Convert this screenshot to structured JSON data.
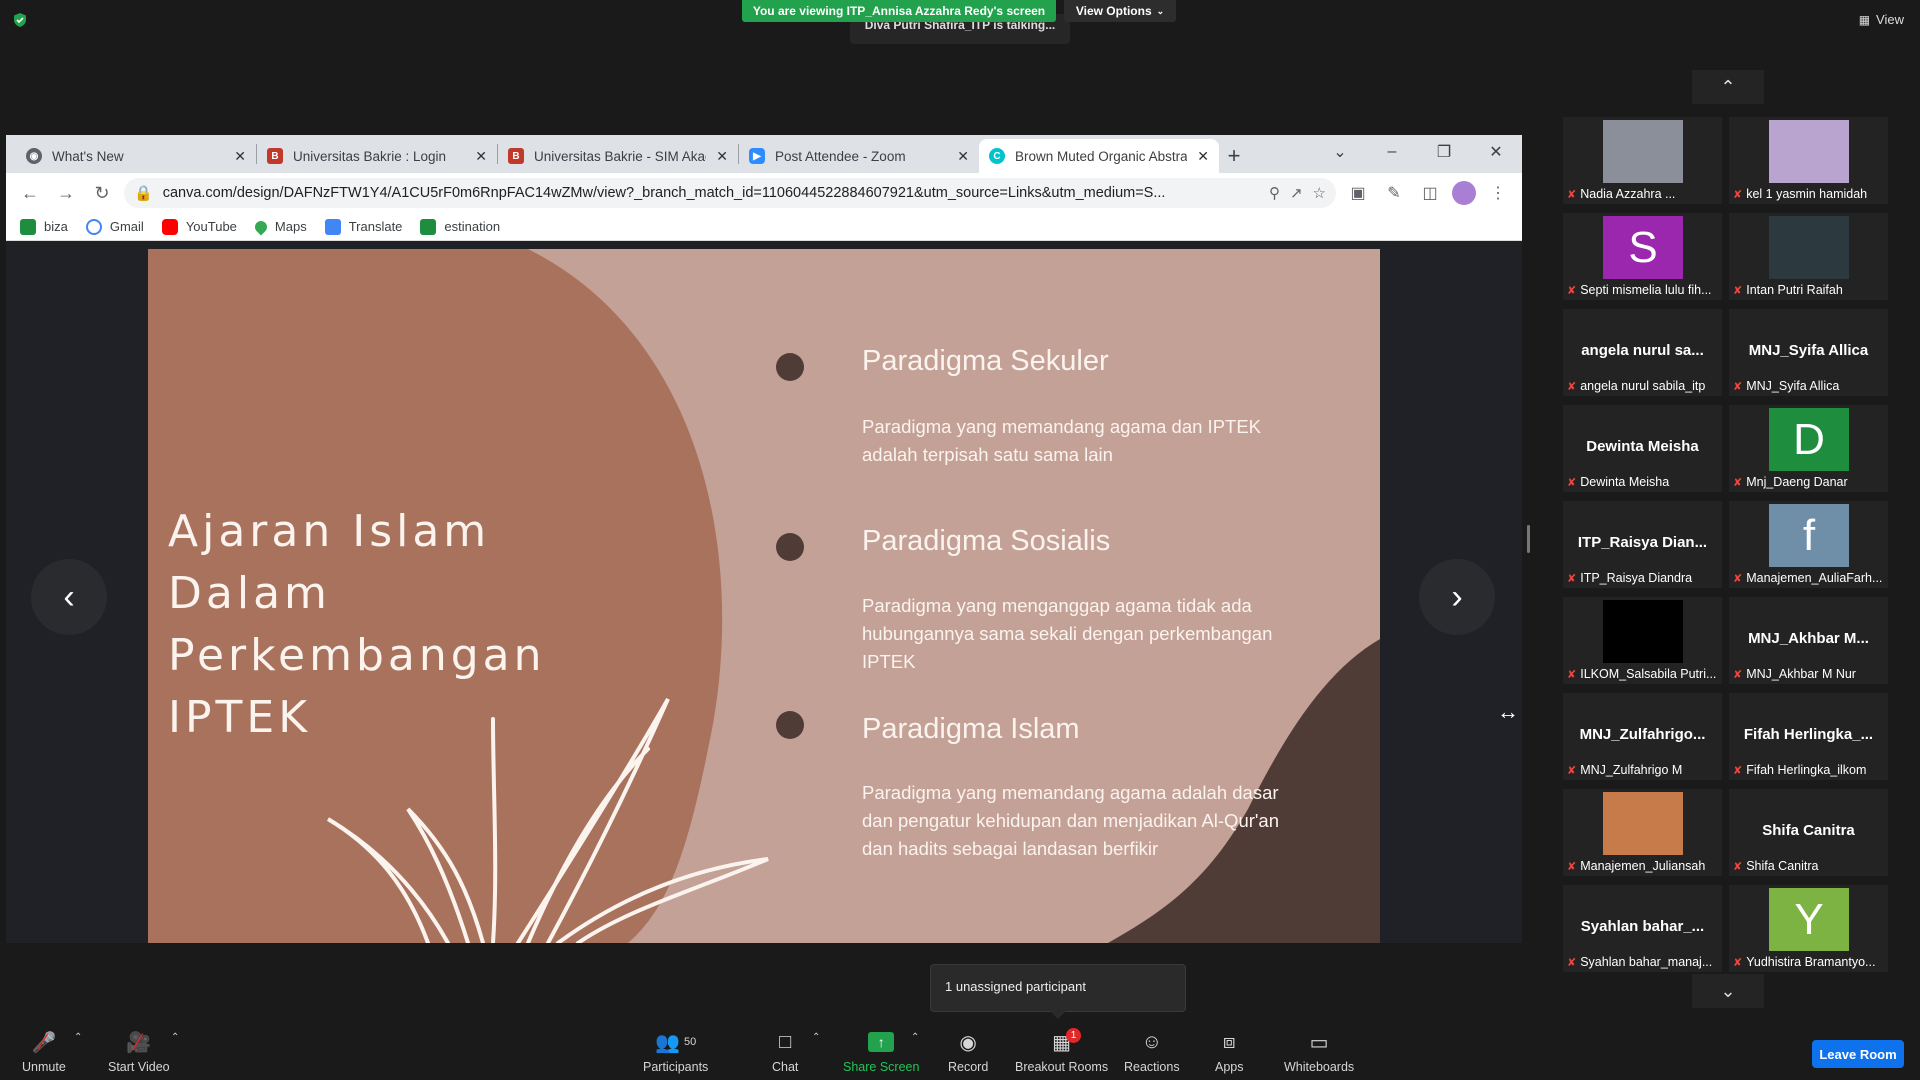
{
  "meeting": {
    "share_banner": "You are viewing ITP_Annisa Azzahra Redy's screen",
    "view_options": "View Options",
    "talking": "Diva Putri Shafira_ITP is talking...",
    "view_label": "View"
  },
  "browser": {
    "tabs": [
      {
        "title": "What's New",
        "icon": "chrome-icon",
        "active": false
      },
      {
        "title": "Universitas Bakrie : Login",
        "icon": "bakrie-icon",
        "active": false
      },
      {
        "title": "Universitas Bakrie - SIM Akad",
        "icon": "bakrie-icon",
        "active": false
      },
      {
        "title": "Post Attendee - Zoom",
        "icon": "zoom-icon",
        "active": false
      },
      {
        "title": "Brown Muted Organic Abstra",
        "icon": "canva-icon",
        "active": true
      }
    ],
    "url": "canva.com/design/DAFNzFTW1Y4/A1CU5rF0m6RnpFAC14wZMw/view?_branch_match_id=1106044522884607921&utm_source=Links&utm_medium=S...",
    "bookmarks": [
      "biza",
      "Gmail",
      "YouTube",
      "Maps",
      "Translate",
      "estination"
    ]
  },
  "slide": {
    "title_lines": [
      "Ajaran Islam",
      "Dalam",
      "Perkembangan",
      "IPTEK"
    ],
    "points": [
      {
        "heading": "Paradigma Sekuler",
        "body": "Paradigma yang memandang agama dan IPTEK adalah terpisah satu sama lain"
      },
      {
        "heading": "Paradigma Sosialis",
        "body": "Paradigma yang menganggap agama tidak ada hubungannya sama sekali dengan perkembangan IPTEK"
      },
      {
        "heading": "Paradigma Islam",
        "body": "Paradigma yang memandang agama adalah dasar dan pengatur kehidupan dan menjadikan Al-Qur'an dan hadits sebagai landasan berfikir"
      }
    ]
  },
  "participants": [
    {
      "label": "Nadia Azzahra ...",
      "big": "",
      "avatar": "photo",
      "color": "#8a8f99"
    },
    {
      "label": "kel 1 yasmin hamidah",
      "big": "",
      "avatar": "photo",
      "color": "#b9a4cf"
    },
    {
      "label": "Septi mismelia lulu fih...",
      "big": "",
      "avatar": "S",
      "color": "#9b27af"
    },
    {
      "label": "Intan Putri Raifah",
      "big": "",
      "avatar": "photo",
      "color": "#2c3a40"
    },
    {
      "label": "angela nurul sabila_itp",
      "big": "angela nurul sa...",
      "avatar": "",
      "color": ""
    },
    {
      "label": "MNJ_Syifa Allica",
      "big": "MNJ_Syifa Allica",
      "avatar": "",
      "color": ""
    },
    {
      "label": "Dewinta Meisha",
      "big": "Dewinta Meisha",
      "avatar": "",
      "color": ""
    },
    {
      "label": "Mnj_Daeng Danar",
      "big": "",
      "avatar": "D",
      "color": "#1e8e3e"
    },
    {
      "label": "ITP_Raisya Diandra",
      "big": "ITP_Raisya Dian...",
      "avatar": "",
      "color": ""
    },
    {
      "label": "Manajemen_AuliaFarh...",
      "big": "",
      "avatar": "f",
      "color": "#6f8fa8"
    },
    {
      "label": "ILKOM_Salsabila Putri...",
      "big": "",
      "avatar": "",
      "color": "#000000"
    },
    {
      "label": "MNJ_Akhbar M Nur",
      "big": "MNJ_Akhbar M...",
      "avatar": "",
      "color": ""
    },
    {
      "label": "MNJ_Zulfahrigo M",
      "big": "MNJ_Zulfahrigo...",
      "avatar": "",
      "color": ""
    },
    {
      "label": "Fifah Herlingka_ilkom",
      "big": "Fifah Herlingka_...",
      "avatar": "",
      "color": ""
    },
    {
      "label": "Manajemen_Juliansah",
      "big": "",
      "avatar": "photo",
      "color": "#c77b4a"
    },
    {
      "label": "Shifa Canitra",
      "big": "Shifa Canitra",
      "avatar": "",
      "color": ""
    },
    {
      "label": "Syahlan bahar_manaj...",
      "big": "Syahlan bahar_...",
      "avatar": "",
      "color": ""
    },
    {
      "label": "Yudhistira Bramantyo...",
      "big": "",
      "avatar": "Y",
      "color": "#7cb342"
    }
  ],
  "toast": "1 unassigned participant",
  "toolbar": {
    "unmute": "Unmute",
    "start_video": "Start Video",
    "participants": "Participants",
    "participants_count": "50",
    "chat": "Chat",
    "share_screen": "Share Screen",
    "record": "Record",
    "breakout_rooms": "Breakout Rooms",
    "breakout_badge": "1",
    "reactions": "Reactions",
    "apps": "Apps",
    "whiteboards": "Whiteboards",
    "leave": "Leave Room"
  }
}
